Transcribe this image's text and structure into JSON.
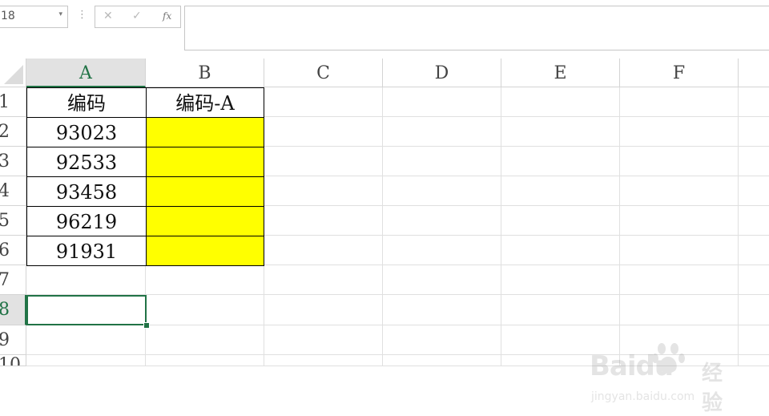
{
  "formula_bar": {
    "name_box": "18",
    "name_box_dropdown": "▾",
    "dots": "⋮",
    "cancel_symbol": "✕",
    "enter_symbol": "✓",
    "fx_label": "fx",
    "formula": ""
  },
  "columns": [
    "A",
    "B",
    "C",
    "D",
    "E",
    "F"
  ],
  "rows": [
    "1",
    "2",
    "3",
    "4",
    "5",
    "6",
    "7",
    "8",
    "9",
    "10"
  ],
  "cells": {
    "A1": "编码",
    "B1": "编码-A",
    "A2": "93023",
    "A3": "92533",
    "A4": "93458",
    "A5": "96219",
    "A6": "91931"
  },
  "selected": {
    "column": "A",
    "row": "8"
  },
  "colors": {
    "accent": "#217346",
    "highlight": "#ffff00",
    "header_selected_bg": "#e2e2e2"
  },
  "watermark": {
    "brand": "Baidu",
    "sub": "经验",
    "url": "jingyan.baidu.com"
  }
}
